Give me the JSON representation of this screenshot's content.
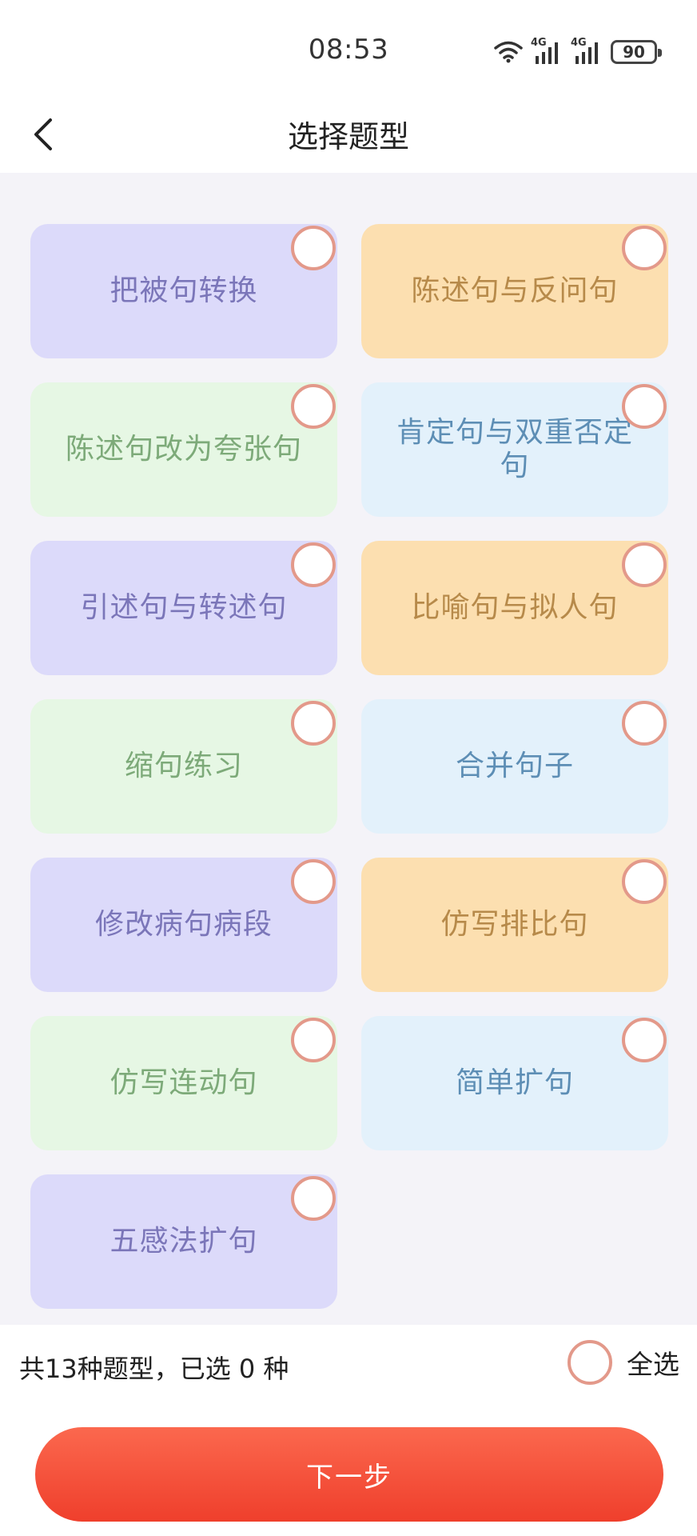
{
  "status_bar": {
    "time": "08:53",
    "network_1": "4G",
    "network_2": "4G",
    "battery": "90"
  },
  "header": {
    "title": "选择题型",
    "back_icon": "chevron-left-icon"
  },
  "question_types": [
    {
      "label": "把被句转换",
      "color": "purple",
      "selected": false
    },
    {
      "label": "陈述句与反问句",
      "color": "orange",
      "selected": false
    },
    {
      "label": "陈述句改为夸张句",
      "color": "green",
      "selected": false
    },
    {
      "label": "肯定句与双重否定句",
      "color": "blue",
      "selected": false
    },
    {
      "label": "引述句与转述句",
      "color": "purple",
      "selected": false
    },
    {
      "label": "比喻句与拟人句",
      "color": "orange",
      "selected": false
    },
    {
      "label": "缩句练习",
      "color": "green",
      "selected": false
    },
    {
      "label": "合并句子",
      "color": "blue",
      "selected": false
    },
    {
      "label": "修改病句病段",
      "color": "purple",
      "selected": false
    },
    {
      "label": "仿写排比句",
      "color": "orange",
      "selected": false
    },
    {
      "label": "仿写连动句",
      "color": "green",
      "selected": false
    },
    {
      "label": "简单扩句",
      "color": "blue",
      "selected": false
    },
    {
      "label": "五感法扩句",
      "color": "purple",
      "selected": false
    }
  ],
  "footer": {
    "summary": "共13种题型，已选 0 种",
    "select_all_label": "全选",
    "next_button_label": "下一步"
  },
  "colors": {
    "accent": "#f04a35",
    "radio_border": "#e3998a",
    "purple_card": "#dcdafa",
    "orange_card": "#fcdfb0",
    "green_card": "#e6f7e4",
    "blue_card": "#e3f1fb"
  }
}
